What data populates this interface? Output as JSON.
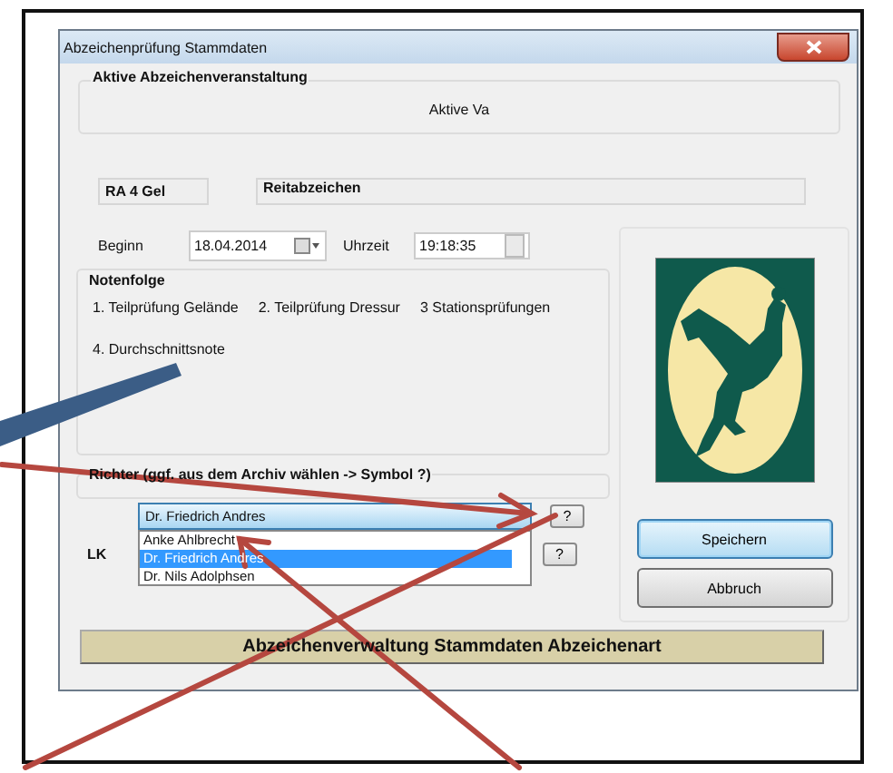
{
  "window": {
    "title": "Abzeichenprüfung Stammdaten"
  },
  "event_group": {
    "title": "Aktive Abzeichenveranstaltung",
    "value": "Aktive Va"
  },
  "badge": {
    "code": "RA 4 Gel",
    "name": "Reitabzeichen"
  },
  "schedule": {
    "date_label": "Beginn",
    "date": "18.04.2014",
    "time_label": "Uhrzeit",
    "time": "19:18:35"
  },
  "grading": {
    "title": "Notenfolge",
    "items": [
      "1. Teilprüfung Gelände",
      "2. Teilprüfung Dressur",
      "3 Stationsprüfungen",
      "4. Durchschnittsnote"
    ]
  },
  "judges": {
    "title": "Richter (ggf. aus dem Archiv wählen -> Symbol ?)",
    "value": "Dr. Friedrich Andres",
    "lookup_button": "?",
    "options": [
      {
        "label": "Anke Ahlbrecht",
        "selected": false
      },
      {
        "label": "Dr. Friedrich Andres",
        "selected": true
      },
      {
        "label": "Dr. Nils Adolphsen",
        "selected": false
      }
    ]
  },
  "lk": {
    "label": "LK",
    "lookup_button": "?"
  },
  "buttons": [
    {
      "label": "Speichern",
      "default": true
    },
    {
      "label": "Abbruch",
      "default": false
    }
  ],
  "footer": {
    "text": "Abzeichenverwaltung Stammdaten Abzeichenart"
  }
}
